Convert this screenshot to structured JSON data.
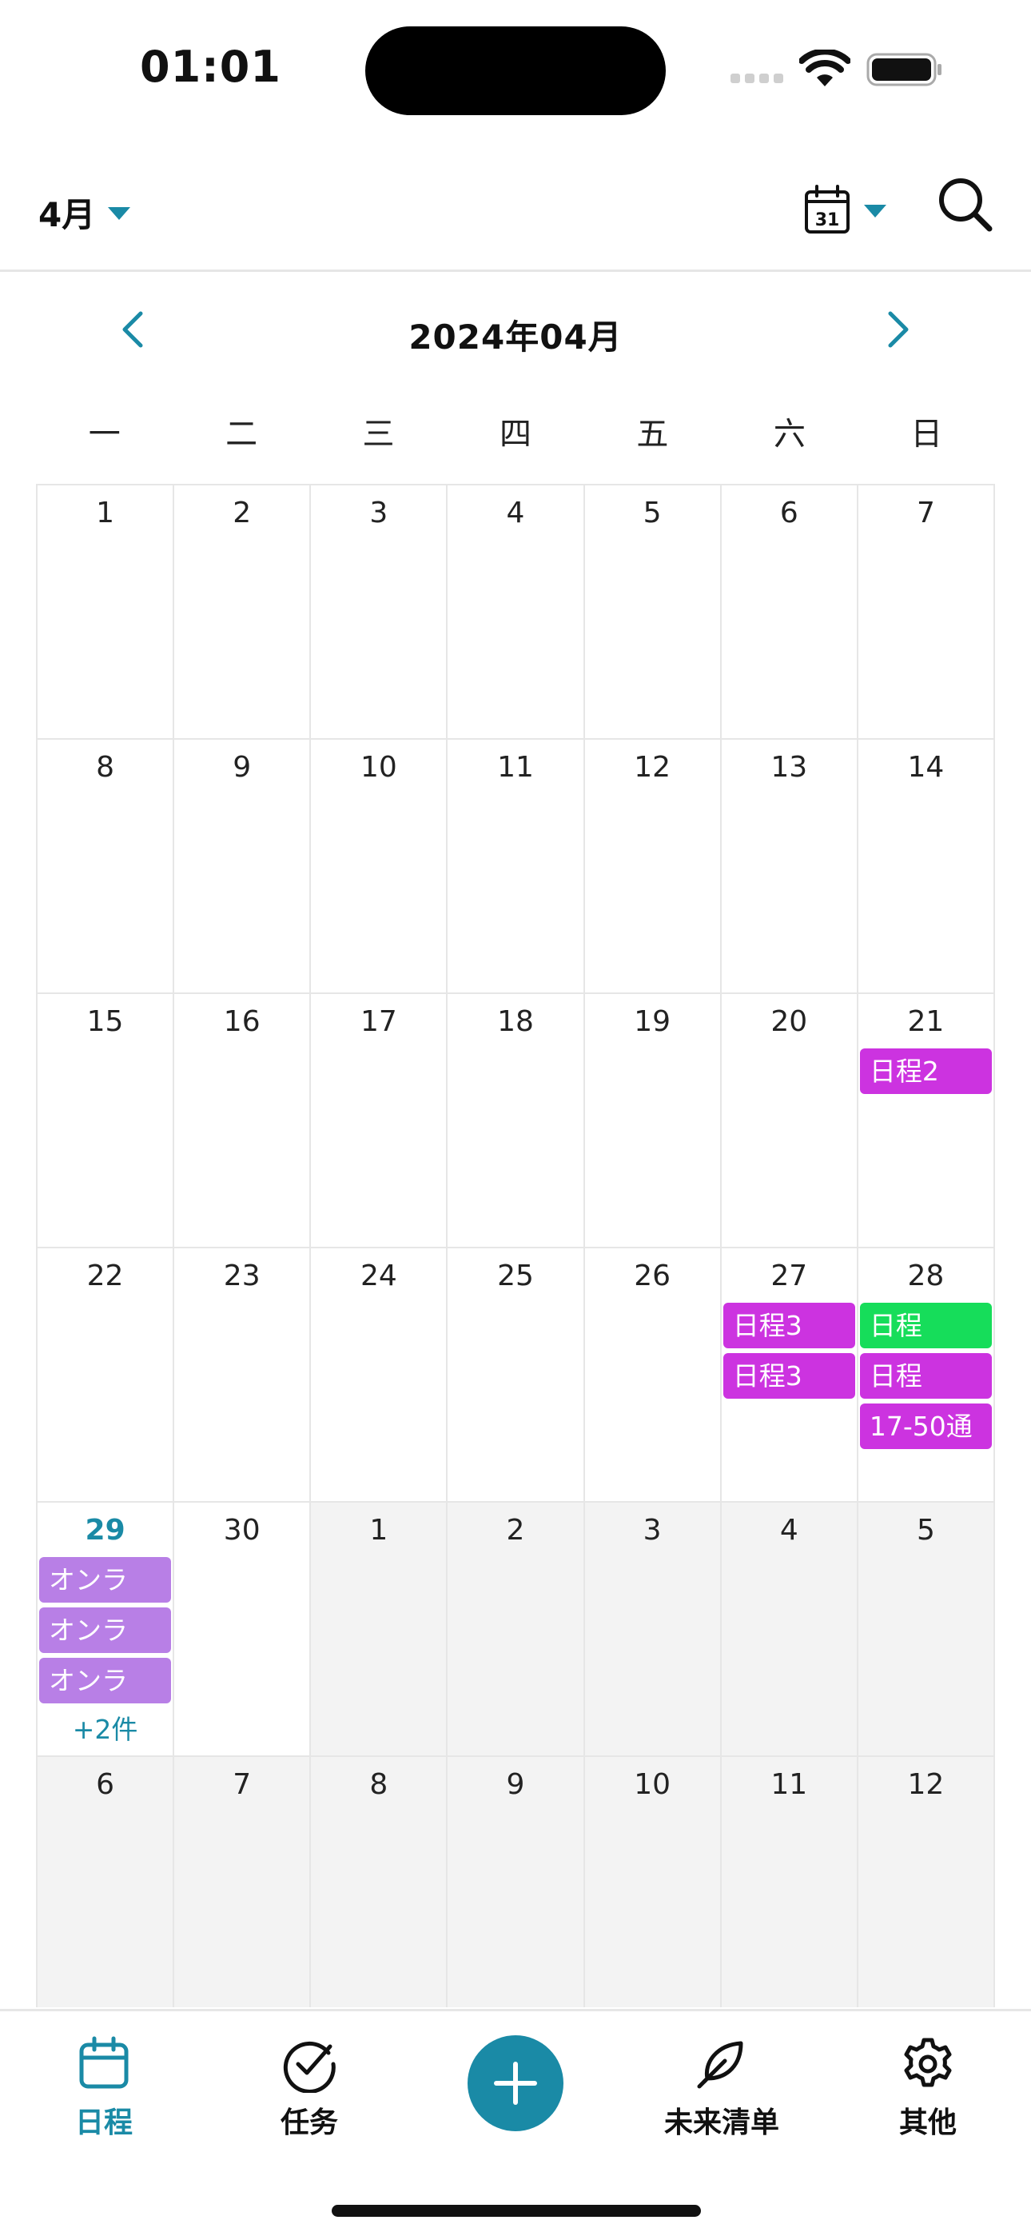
{
  "status": {
    "time": "01:01"
  },
  "header": {
    "month_label": "4月",
    "calendar_icon_day": "31"
  },
  "nav": {
    "title": "2024年04月"
  },
  "weekdays": [
    "一",
    "二",
    "三",
    "四",
    "五",
    "六",
    "日"
  ],
  "weeks": [
    [
      {
        "day": "1"
      },
      {
        "day": "2"
      },
      {
        "day": "3"
      },
      {
        "day": "4"
      },
      {
        "day": "5"
      },
      {
        "day": "6"
      },
      {
        "day": "7"
      }
    ],
    [
      {
        "day": "8"
      },
      {
        "day": "9"
      },
      {
        "day": "10"
      },
      {
        "day": "11"
      },
      {
        "day": "12"
      },
      {
        "day": "13"
      },
      {
        "day": "14"
      }
    ],
    [
      {
        "day": "15"
      },
      {
        "day": "16"
      },
      {
        "day": "17"
      },
      {
        "day": "18"
      },
      {
        "day": "19"
      },
      {
        "day": "20"
      },
      {
        "day": "21",
        "events": [
          {
            "label": "日程2",
            "color": "#cc33e0"
          }
        ]
      }
    ],
    [
      {
        "day": "22"
      },
      {
        "day": "23"
      },
      {
        "day": "24"
      },
      {
        "day": "25"
      },
      {
        "day": "26"
      },
      {
        "day": "27",
        "events": [
          {
            "label": "日程3",
            "color": "#cc33e0"
          },
          {
            "label": "日程3",
            "color": "#cc33e0"
          }
        ]
      },
      {
        "day": "28",
        "events": [
          {
            "label": "日程",
            "color": "#16dd5a"
          },
          {
            "label": "日程",
            "color": "#cc33e0"
          },
          {
            "label": "17-50通",
            "color": "#cc33e0"
          }
        ]
      }
    ],
    [
      {
        "day": "29",
        "today": true,
        "events": [
          {
            "label": "オンラ",
            "color": "#b87fe6"
          },
          {
            "label": "オンラ",
            "color": "#b87fe6"
          },
          {
            "label": "オンラ",
            "color": "#b87fe6"
          }
        ],
        "more": "+2件"
      },
      {
        "day": "30"
      },
      {
        "day": "1",
        "other": true
      },
      {
        "day": "2",
        "other": true
      },
      {
        "day": "3",
        "other": true
      },
      {
        "day": "4",
        "other": true
      },
      {
        "day": "5",
        "other": true
      }
    ],
    [
      {
        "day": "6",
        "other": true
      },
      {
        "day": "7",
        "other": true
      },
      {
        "day": "8",
        "other": true
      },
      {
        "day": "9",
        "other": true
      },
      {
        "day": "10",
        "other": true
      },
      {
        "day": "11",
        "other": true
      },
      {
        "day": "12",
        "other": true
      }
    ]
  ],
  "tabs": {
    "schedule": "日程",
    "tasks": "任务",
    "future_list": "未来清单",
    "other": "其他"
  },
  "colors": {
    "accent": "#1a8aa6",
    "event_magenta": "#cc33e0",
    "event_green": "#16dd5a",
    "event_lavender": "#b87fe6"
  }
}
